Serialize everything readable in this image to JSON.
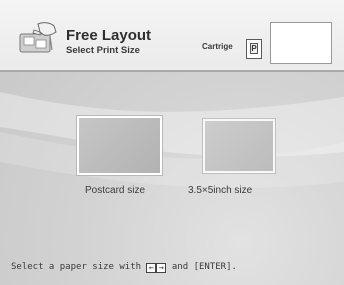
{
  "header": {
    "title": "Free Layout",
    "subtitle": "Select Print Size",
    "cartridge_label": "Cartrige",
    "cartridge_type": "P"
  },
  "sizes": [
    {
      "label": "Postcard size",
      "selected": true
    },
    {
      "label": "3.5×5inch size",
      "selected": false
    }
  ],
  "footer": {
    "help_prefix": "Select a paper size with",
    "key_left": "←",
    "key_right": "→",
    "help_suffix": "and [ENTER]."
  },
  "icons": {
    "app": "hand-pointer-icon",
    "cartridge": "cartridge-icon"
  }
}
